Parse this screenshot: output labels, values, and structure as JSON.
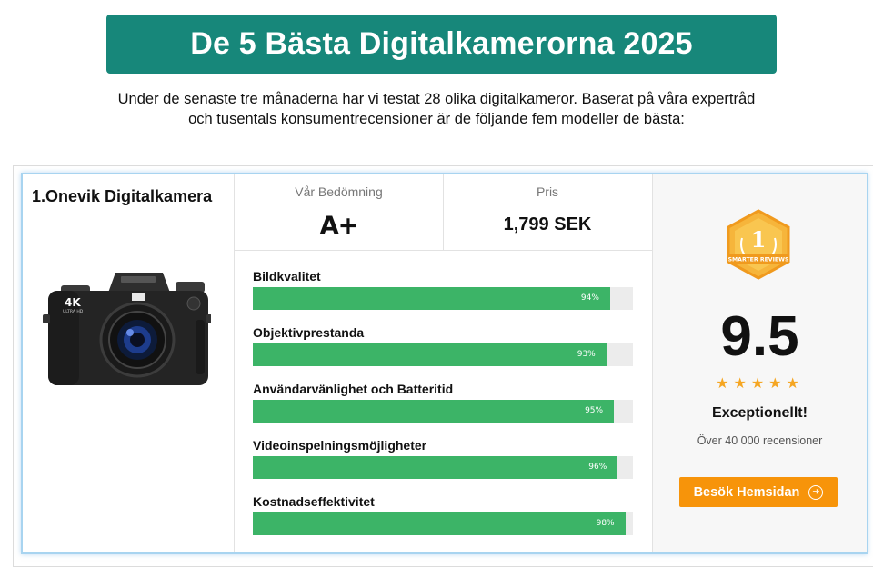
{
  "header": {
    "title": "De 5 Bästa Digitalkamerorna 2025",
    "intro_line1": "Under de senaste tre månaderna har vi testat 28 olika digitalkameror. Baserat på våra expertråd",
    "intro_line2": "och tusentals konsumentrecensioner är de följande fem modeller de bästa:"
  },
  "product": {
    "name": "1.Onevik Digitalkamera",
    "image_icon": "camera-photo",
    "rating_label": "Vår Bedömning",
    "rating_value": "A+",
    "price_label": "Pris",
    "price_value": "1,799 SEK",
    "criteria": [
      {
        "label": "Bildkvalitet",
        "percent": 94,
        "percent_text": "94%"
      },
      {
        "label": "Objektivprestanda",
        "percent": 93,
        "percent_text": "93%"
      },
      {
        "label": "Användarvänlighet och Batteritid",
        "percent": 95,
        "percent_text": "95%"
      },
      {
        "label": "Videoinspelningsmöjligheter",
        "percent": 96,
        "percent_text": "96%"
      },
      {
        "label": "Kostnadseffektivitet",
        "percent": 98,
        "percent_text": "98%"
      }
    ],
    "badge_rank": "1",
    "badge_text": "SMARTER REVIEWS",
    "score": "9.5",
    "stars": "★★★★★",
    "star_count": 5,
    "verdict": "Exceptionellt!",
    "reviews": "Över 40 000 recensioner",
    "cta_label": "Besök Hemsidan"
  },
  "colors": {
    "banner": "#17877a",
    "bar_fill": "#3cb467",
    "cta": "#f7940a",
    "stars": "#f5a623",
    "card_border": "#a8d4f0"
  }
}
